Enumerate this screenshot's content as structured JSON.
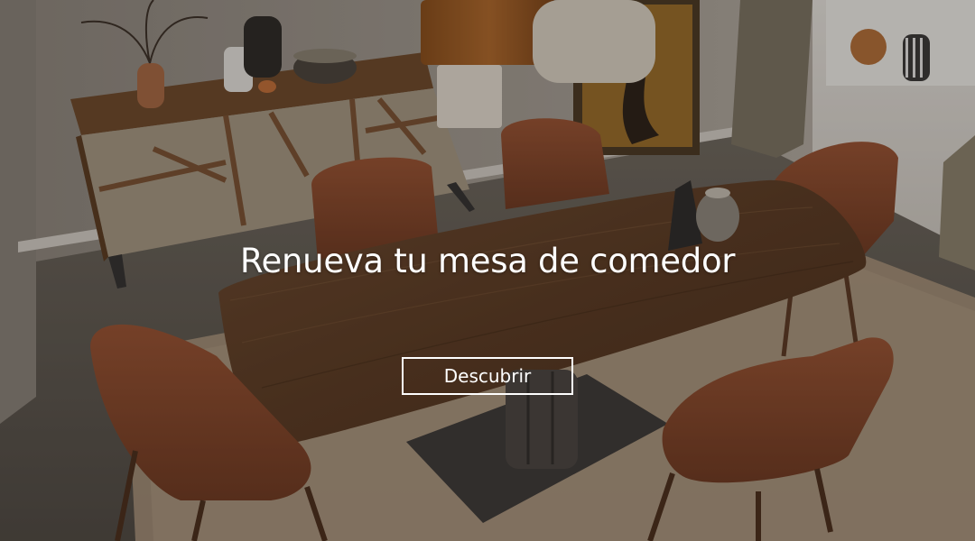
{
  "banner": {
    "title": "Renueva tu mesa de comedor",
    "cta_label": "Descubrir"
  },
  "colors": {
    "text": "#ffffff",
    "button_border": "#ffffff",
    "wall": "#a49d94",
    "floor": "#5f5a52",
    "walnut": "#5a3a22",
    "upholstery": "#8a4a2c"
  }
}
